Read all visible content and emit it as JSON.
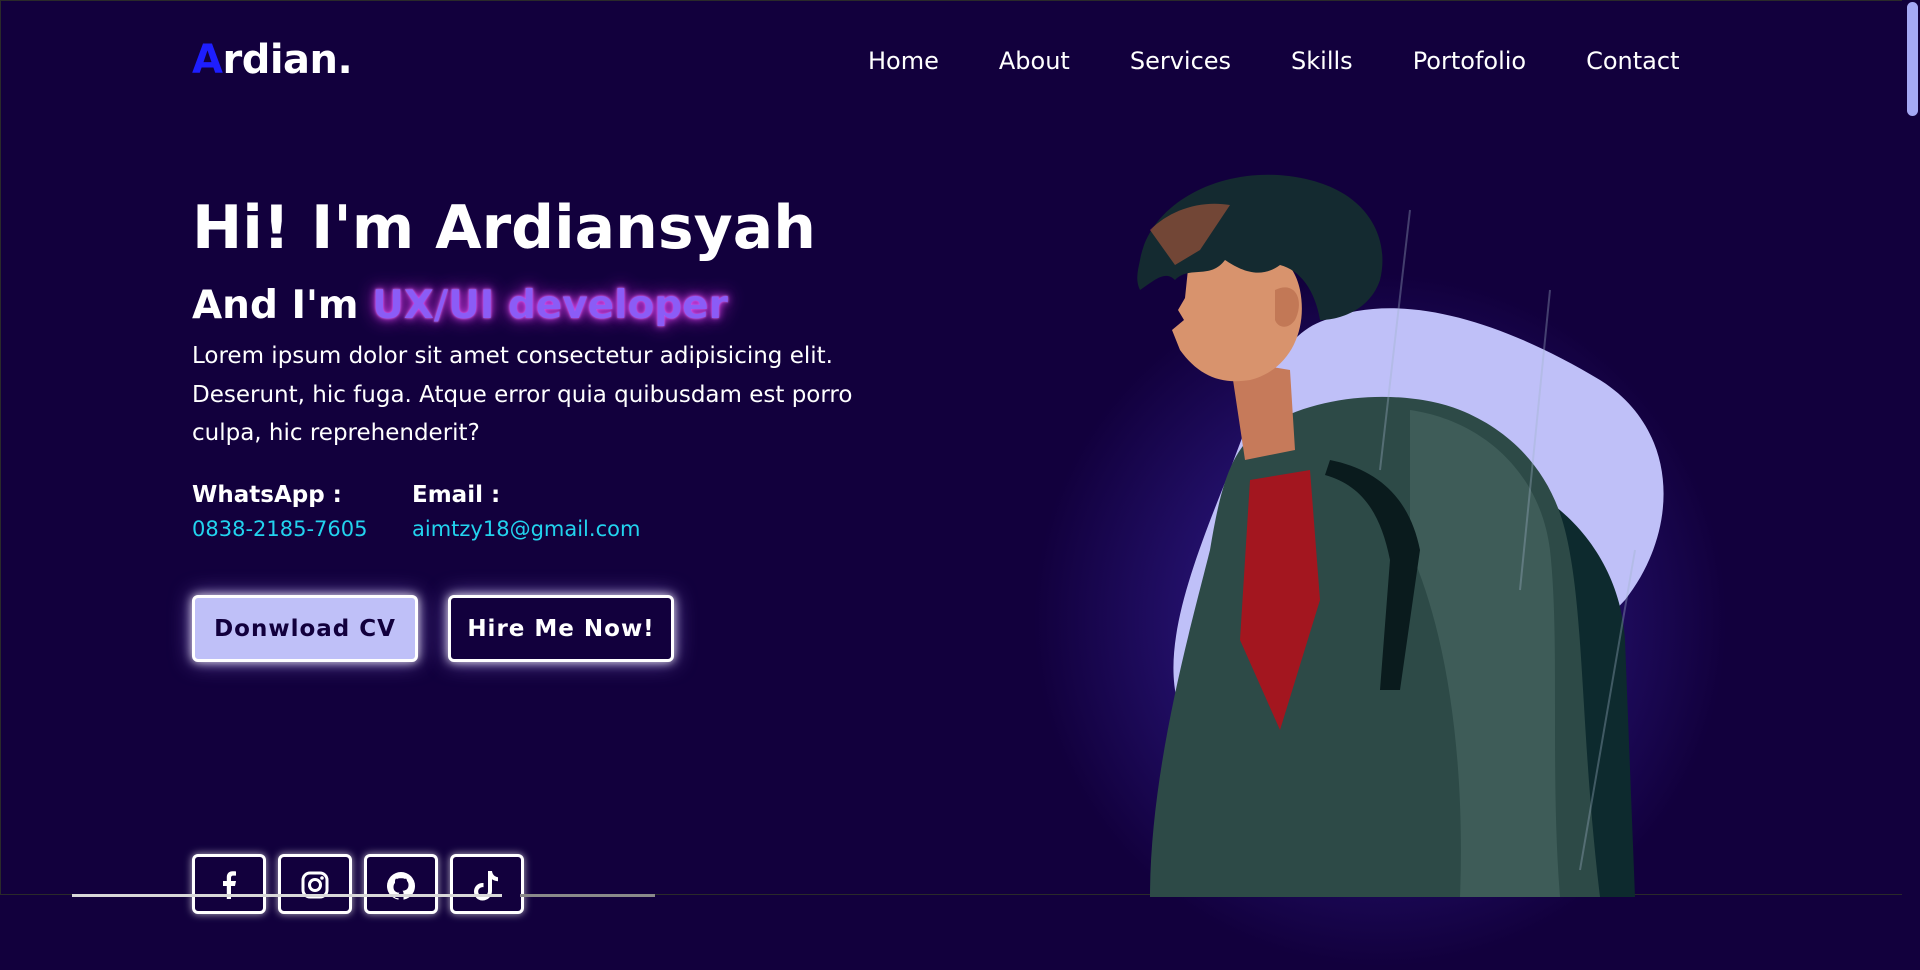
{
  "brand": {
    "logo_first": "A",
    "logo_rest": "rdian."
  },
  "nav": [
    "Home",
    "About",
    "Services",
    "Skills",
    "Portofolio",
    "Contact"
  ],
  "hero": {
    "title": "Hi! I'm Ardiansyah",
    "subtitle_prefix": "And I'm",
    "role": "UX/UI developer",
    "description": "Lorem ipsum dolor sit amet consectetur adipisicing elit. Deserunt, hic fuga. Atque error quia quibusdam est porro culpa, hic reprehenderit?"
  },
  "contact": {
    "whatsapp_label": "WhatsApp :",
    "whatsapp_value": "0838-2185-7605",
    "email_label": "Email :",
    "email_value": "aimtzy18@gmail.com"
  },
  "buttons": {
    "download": "Donwload CV",
    "hire": "Hire Me Now!"
  },
  "social": [
    "facebook-icon",
    "instagram-icon",
    "github-icon",
    "tiktok-icon"
  ],
  "colors": {
    "background": "#12003d",
    "logo_accent": "#1e1eff",
    "contact_value": "#22d3ee",
    "role_glow": "#c026d3",
    "button_light": "#bfc0f8",
    "blob": "#bfc0f8"
  }
}
